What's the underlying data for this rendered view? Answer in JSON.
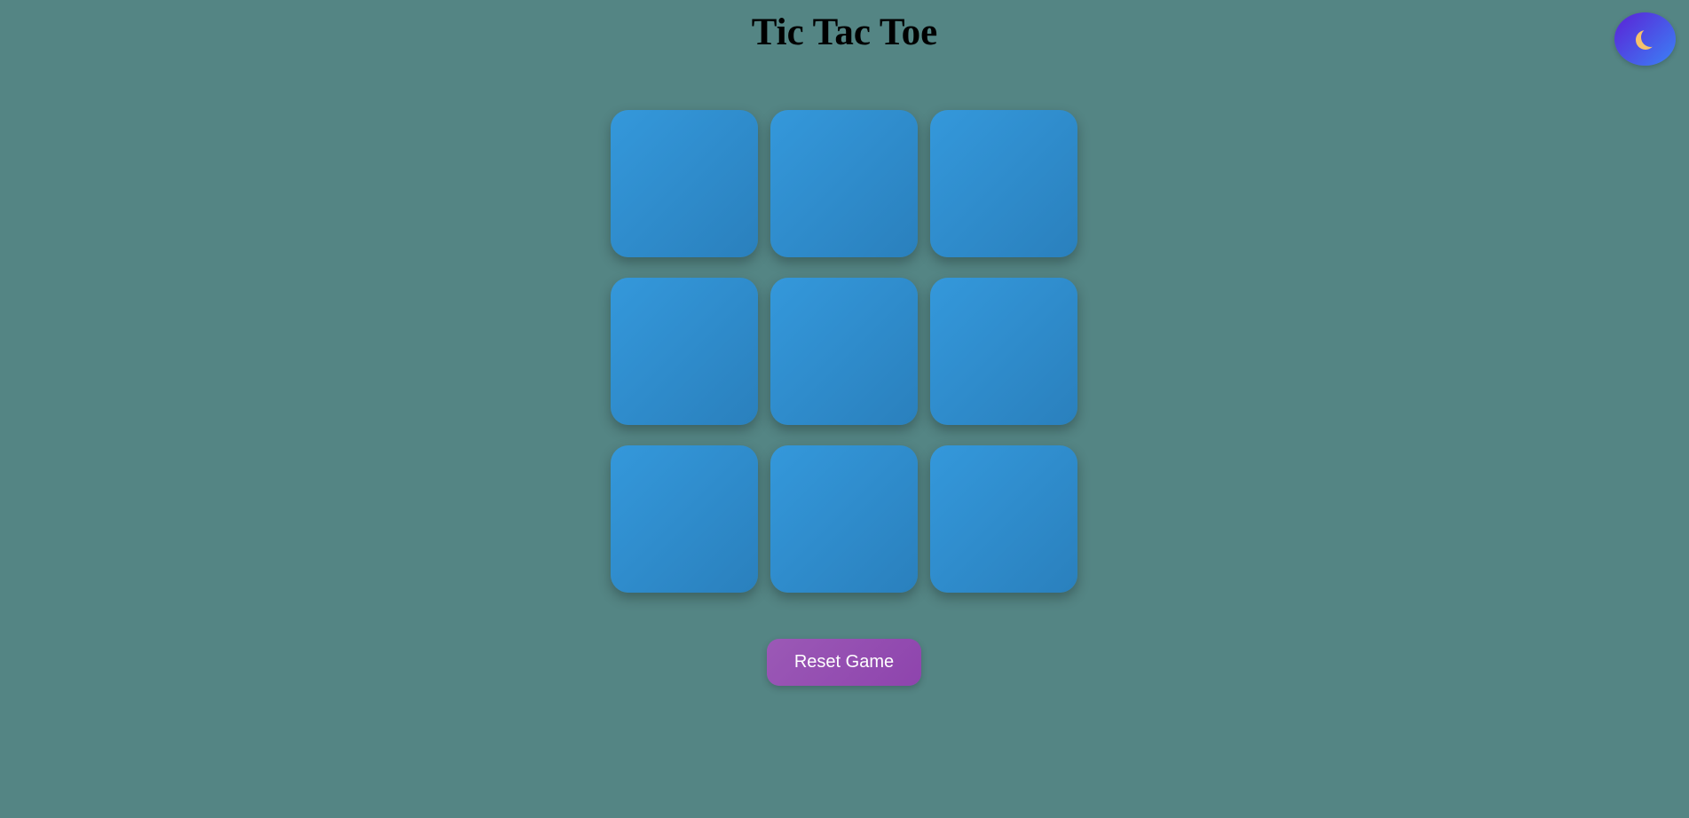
{
  "header": {
    "title": "Tic Tac Toe"
  },
  "theme_toggle": {
    "icon": "moon-icon"
  },
  "board": {
    "cells": [
      "",
      "",
      "",
      "",
      "",
      "",
      "",
      "",
      ""
    ]
  },
  "controls": {
    "reset_label": "Reset Game"
  },
  "colors": {
    "background": "#548584",
    "cell": "#3498db",
    "reset_button": "#9b59b6",
    "toggle_start": "#5b21d6",
    "toggle_end": "#3b82f6"
  }
}
